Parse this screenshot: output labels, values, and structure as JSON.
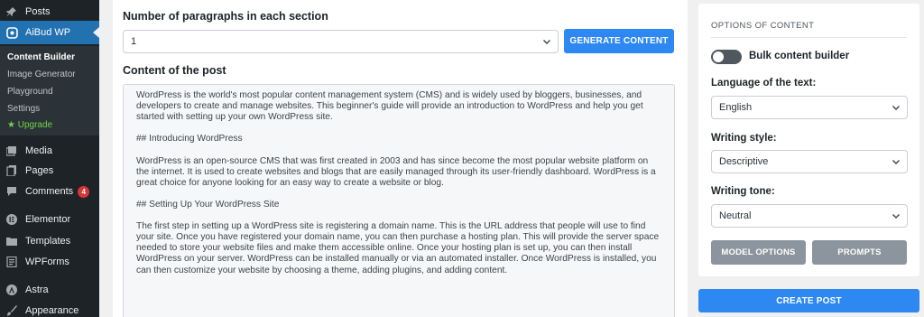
{
  "sidebar": {
    "items": [
      {
        "label": "Posts",
        "icon": "pin-icon"
      },
      {
        "label": "AiBud WP",
        "icon": "aibud-icon"
      },
      {
        "label": "Media",
        "icon": "media-icon"
      },
      {
        "label": "Pages",
        "icon": "pages-icon"
      },
      {
        "label": "Comments",
        "icon": "comments-icon",
        "badge": "4"
      },
      {
        "label": "Elementor",
        "icon": "elementor-icon"
      },
      {
        "label": "Templates",
        "icon": "folder-icon"
      },
      {
        "label": "WPForms",
        "icon": "wpforms-icon"
      },
      {
        "label": "Astra",
        "icon": "astra-icon"
      },
      {
        "label": "Appearance",
        "icon": "brush-icon"
      }
    ],
    "submenu": [
      "Content Builder",
      "Image Generator",
      "Playground",
      "Settings",
      "Upgrade"
    ],
    "colors": {
      "background": "#1d2327",
      "active": "#2271b1",
      "upgrade": "#6fd34a",
      "badge": "#d63638"
    }
  },
  "main": {
    "paragraphs_label": "Number of paragraphs in each section",
    "paragraphs_value": "1",
    "generate_button": "GENERATE CONTENT",
    "content_label": "Content of the post",
    "content_paragraphs": [
      "WordPress is the world's most popular content management system (CMS) and is widely used by bloggers, businesses, and developers to create and manage websites. This beginner's guide will provide an introduction to WordPress and help you get started with setting up your own WordPress site.",
      "## Introducing WordPress",
      "WordPress is an open-source CMS that was first created in 2003 and has since become the most popular website platform on the internet. It is used to create websites and blogs that are easily managed through its user-friendly dashboard. WordPress is a great choice for anyone looking for an easy way to create a website or blog.",
      "## Setting Up Your WordPress Site",
      "The first step in setting up a WordPress site is registering a domain name. This is the URL address that people will use to find your site. Once you have registered your domain name, you can then purchase a hosting plan. This will provide the server space needed to store your website files and make them accessible online. Once your hosting plan is set up, you can then install WordPress on your server. WordPress can be installed manually or via an automated installer. Once WordPress is installed, you can then customize your website by choosing a theme, adding plugins, and adding content."
    ],
    "accent_color": "#2d88f2"
  },
  "options": {
    "title": "OPTIONS OF CONTENT",
    "bulk_label": "Bulk content builder",
    "bulk_enabled": false,
    "language_label": "Language of the text:",
    "language_value": "English",
    "style_label": "Writing style:",
    "style_value": "Descriptive",
    "tone_label": "Writing tone:",
    "tone_value": "Neutral",
    "model_button": "MODEL OPTIONS",
    "prompts_button": "PROMPTS",
    "create_button": "CREATE POST"
  }
}
